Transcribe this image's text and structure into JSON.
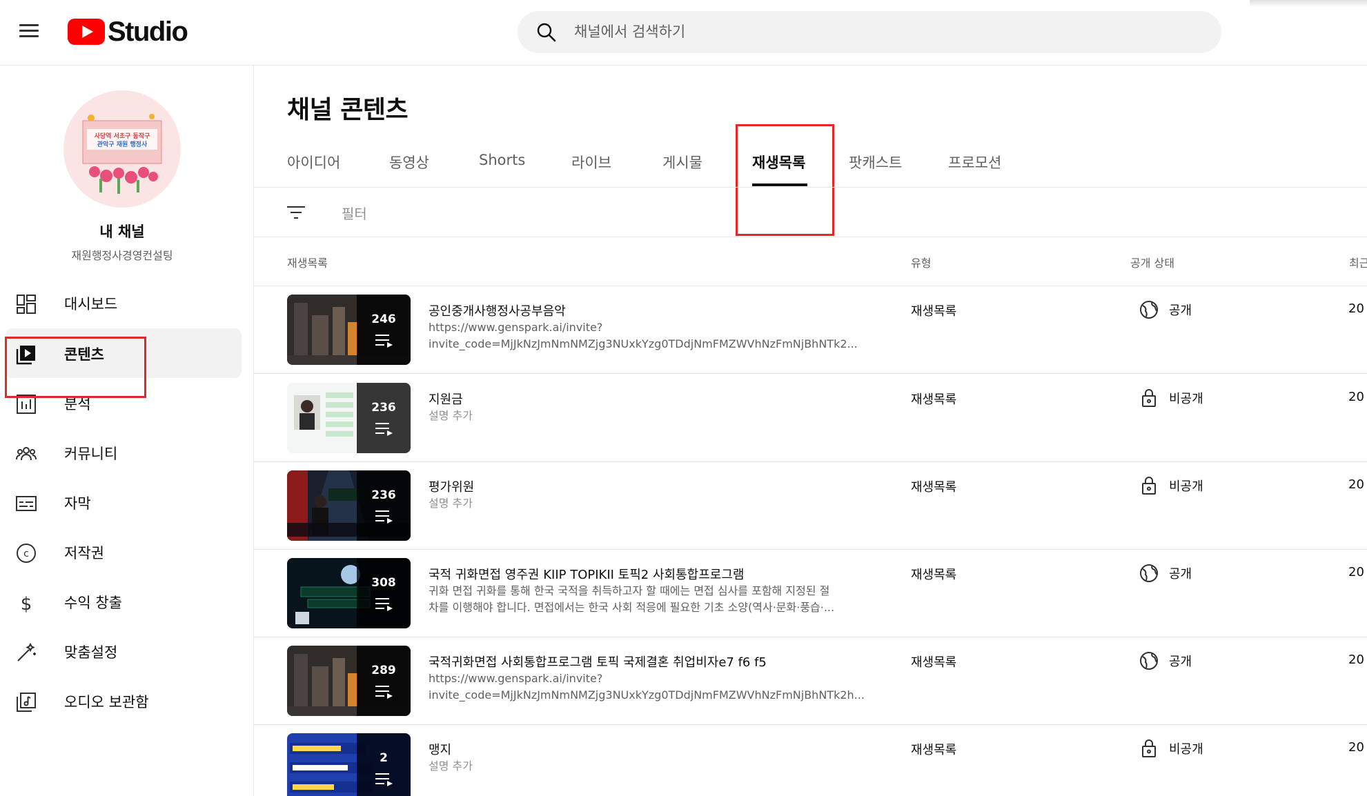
{
  "header": {
    "logo_text": "Studio",
    "search_placeholder": "채널에서 검색하기"
  },
  "sidebar": {
    "channel_name": "내 채널",
    "channel_sub": "재원행정사경영컨설팅",
    "avatar_text": [
      "사당역 서초구 동작구",
      "관악구 재원 행정사"
    ],
    "items": [
      {
        "label": "대시보드",
        "icon": "dashboard-icon"
      },
      {
        "label": "콘텐츠",
        "icon": "content-icon",
        "active": true
      },
      {
        "label": "분석",
        "icon": "analytics-icon"
      },
      {
        "label": "커뮤니티",
        "icon": "community-icon"
      },
      {
        "label": "자막",
        "icon": "subtitles-icon"
      },
      {
        "label": "저작권",
        "icon": "copyright-icon"
      },
      {
        "label": "수익 창출",
        "icon": "monetization-icon"
      },
      {
        "label": "맞춤설정",
        "icon": "customization-icon"
      },
      {
        "label": "오디오 보관함",
        "icon": "audio-library-icon"
      }
    ]
  },
  "main": {
    "title": "채널 콘텐츠",
    "tabs": [
      {
        "label": "아이디어"
      },
      {
        "label": "동영상"
      },
      {
        "label": "Shorts"
      },
      {
        "label": "라이브"
      },
      {
        "label": "게시물"
      },
      {
        "label": "재생목록",
        "active": true
      },
      {
        "label": "팟캐스트"
      },
      {
        "label": "프로모션"
      }
    ],
    "filter_label": "필터",
    "columns": {
      "playlist": "재생목록",
      "type": "유형",
      "visibility": "공개 상태",
      "last_updated": "최근"
    },
    "rows": [
      {
        "count": "246",
        "title": "공인중개사행정사공부음악",
        "desc": "https://www.genspark.ai/invite?",
        "desc2": "invite_code=MjJkNzJmNmNMZjg3NUxkYzg0TDdjNmFMZWVhNzFmNjBhNTk2...",
        "type": "재생목록",
        "visibility": "공개",
        "vis_icon": "globe-icon",
        "date": "20"
      },
      {
        "count": "236",
        "title": "지원금",
        "desc": "설명 추가",
        "desc2": "",
        "type": "재생목록",
        "visibility": "비공개",
        "vis_icon": "lock-icon",
        "date": "20"
      },
      {
        "count": "236",
        "title": "평가위원",
        "desc": "설명 추가",
        "desc2": "",
        "type": "재생목록",
        "visibility": "비공개",
        "vis_icon": "lock-icon",
        "date": "20"
      },
      {
        "count": "308",
        "title": "국적 귀화면접 영주권 KIIP TOPIKII 토픽2 사회통합프로그램",
        "desc": "귀화 면접 귀화를 통해 한국 국적을 취득하고자 할 때에는 면접 심사를 포함해 지정된 절",
        "desc2": "차를 이행해야 합니다. 면접에서는 한국 사회 적응에 필요한 기초 소양(역사·문화·풍습·...",
        "type": "재생목록",
        "visibility": "공개",
        "vis_icon": "globe-icon",
        "date": "20"
      },
      {
        "count": "289",
        "title": "국적귀화면접 사회통합프로그램 토픽 국제결혼 취업비자e7 f6 f5",
        "desc": "https://www.genspark.ai/invite?",
        "desc2": "invite_code=MjJkNzJmNmNMZjg3NUxkYzg0TDdjNmFMZWVhNzFmNjBhNTk2h...",
        "type": "재생목록",
        "visibility": "공개",
        "vis_icon": "globe-icon",
        "date": "20"
      },
      {
        "count": "2",
        "title": "맹지",
        "desc": "설명 추가",
        "desc2": "",
        "type": "재생목록",
        "visibility": "비공개",
        "vis_icon": "lock-icon",
        "date": "20"
      }
    ]
  },
  "colors": {
    "brand_red": "#ff0000",
    "highlight_box": "#e32727",
    "active_nav_bg": "#f2f2f2"
  }
}
